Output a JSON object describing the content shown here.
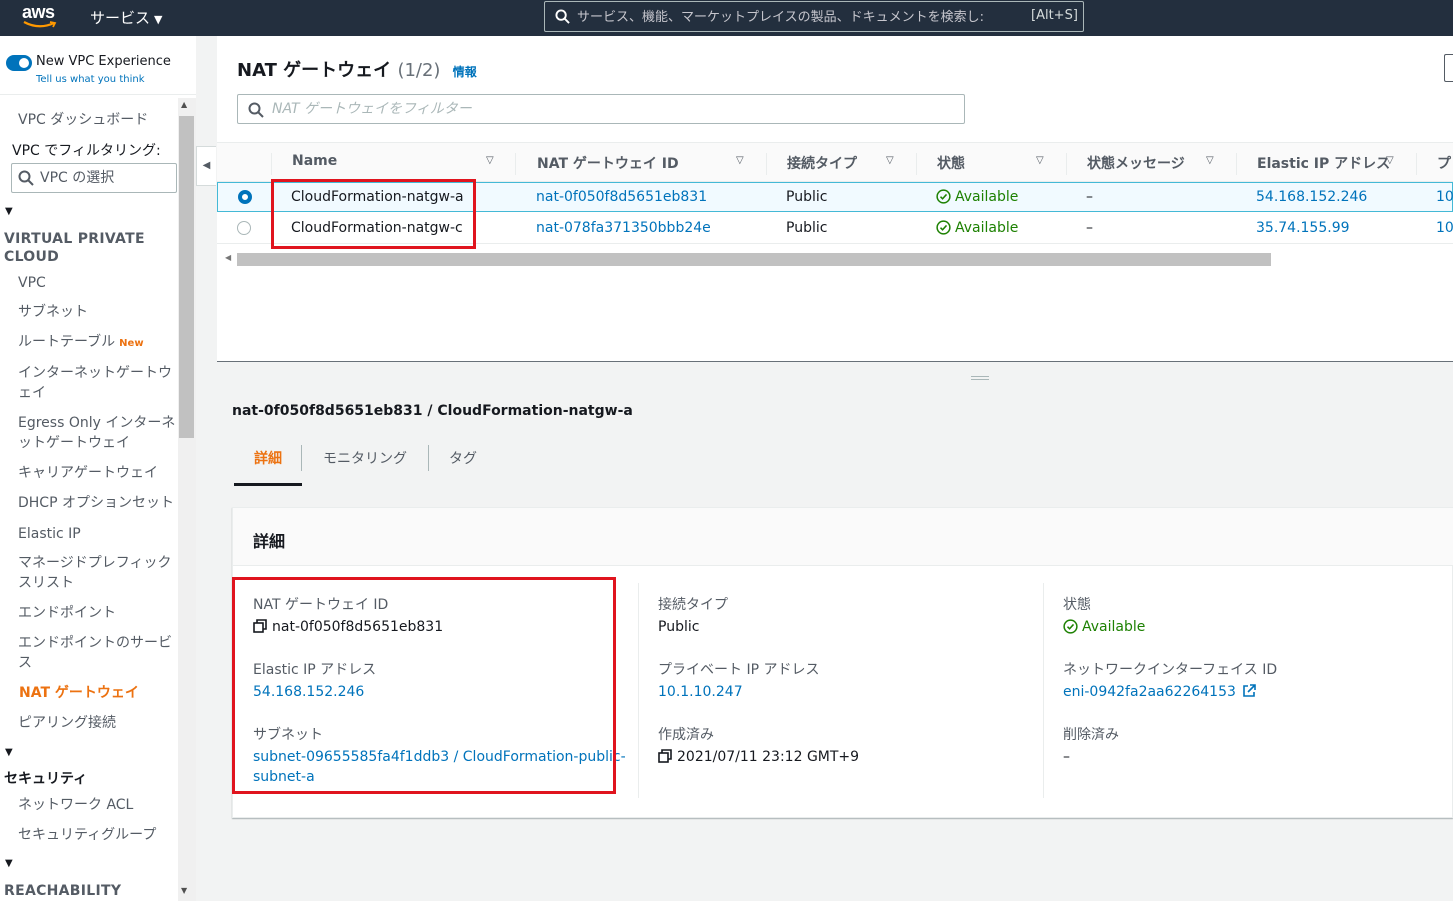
{
  "topnav": {
    "logo_text": "aws",
    "services_label": "サービス",
    "search_placeholder": "サービス、機能、マーケットプレイスの製品、ドキュメントを検索し:",
    "search_shortcut": "[Alt+S]"
  },
  "sidebar": {
    "toggle_label": "New VPC Experience",
    "toggle_sub": "Tell us what you think",
    "dashboard": "VPC ダッシュボード",
    "filter_label": "VPC でフィルタリング:",
    "vpc_select_placeholder": "VPC の選択",
    "section_vpc": "VIRTUAL PRIVATE CLOUD",
    "items": [
      {
        "label": "VPC"
      },
      {
        "label": "サブネット"
      },
      {
        "label": "ルートテーブル",
        "badge": "New"
      },
      {
        "label": "インターネットゲートウェイ"
      },
      {
        "label": "Egress Only インターネットゲートウェイ"
      },
      {
        "label": "キャリアゲートウェイ"
      },
      {
        "label": "DHCP オプションセット"
      },
      {
        "label": "Elastic IP"
      },
      {
        "label": "マネージドプレフィックスリスト"
      },
      {
        "label": "エンドポイント"
      },
      {
        "label": "エンドポイントのサービス"
      },
      {
        "label": "NAT ゲートウェイ",
        "active": true
      },
      {
        "label": "ピアリング接続"
      }
    ],
    "section_security": "セキュリティ",
    "security_items": [
      {
        "label": "ネットワーク ACL"
      },
      {
        "label": "セキュリティグループ"
      }
    ],
    "section_reachability": "REACHABILITY"
  },
  "main": {
    "title": "NAT ゲートウェイ",
    "count": "(1/2)",
    "info_link": "情報",
    "filter_placeholder": "NAT ゲートウェイをフィルター",
    "columns": [
      "Name",
      "NAT ゲートウェイ ID",
      "接続タイプ",
      "状態",
      "状態メッセージ",
      "Elastic IP アドレス",
      "プ"
    ],
    "rows": [
      {
        "selected": true,
        "name": "CloudFormation-natgw-a",
        "id": "nat-0f050f8d5651eb831",
        "type": "Public",
        "state": "Available",
        "message": "–",
        "eip": "54.168.152.246",
        "private": "10"
      },
      {
        "selected": false,
        "name": "CloudFormation-natgw-c",
        "id": "nat-078fa371350bbb24e",
        "type": "Public",
        "state": "Available",
        "message": "–",
        "eip": "35.74.155.99",
        "private": "10"
      }
    ]
  },
  "detail": {
    "title": "nat-0f050f8d5651eb831 / CloudFormation-natgw-a",
    "tabs": [
      "詳細",
      "モニタリング",
      "タグ"
    ],
    "active_tab": "詳細",
    "panel_title": "詳細",
    "nat_id_label": "NAT ゲートウェイ ID",
    "nat_id": "nat-0f050f8d5651eb831",
    "eip_label": "Elastic IP アドレス",
    "eip": "54.168.152.246",
    "subnet_label": "サブネット",
    "subnet_line1": "subnet-09655585fa4f1ddb3 / CloudFormation-public-",
    "subnet_line2": "subnet-a",
    "conn_type_label": "接続タイプ",
    "conn_type": "Public",
    "private_ip_label": "プライベート IP アドレス",
    "private_ip": "10.1.10.247",
    "created_label": "作成済み",
    "created": "2021/07/11 23:12 GMT+9",
    "state_label": "状態",
    "state": "Available",
    "eni_label": "ネットワークインターフェイス ID",
    "eni": "eni-0942fa2aa62264153",
    "deleted_label": "削除済み",
    "deleted": "–"
  },
  "colors": {
    "nav_bg": "#232f3e",
    "accent_orange": "#ec7211",
    "link_blue": "#0073bb",
    "status_green": "#1d8102",
    "highlight_red": "#e0141e"
  }
}
